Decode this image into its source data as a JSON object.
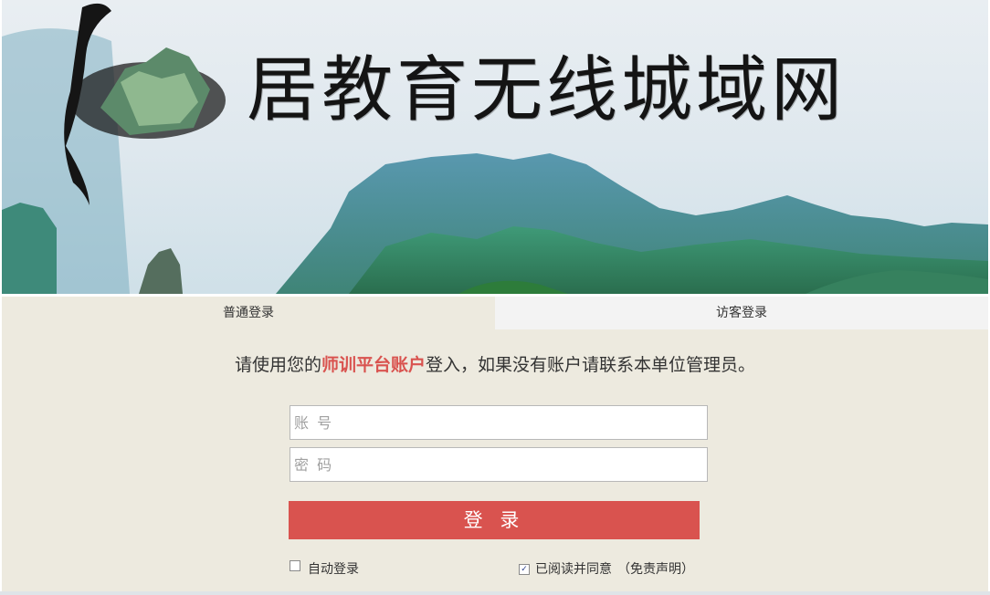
{
  "banner": {
    "title": "居教育无线城域网",
    "logo_icon": "ink-mountain-logo-icon"
  },
  "tabs": [
    {
      "label": "普通登录",
      "active": true
    },
    {
      "label": "访客登录",
      "active": false
    }
  ],
  "notice": {
    "prefix": "请使用您的",
    "highlight": "师训平台账户",
    "suffix": "登入，如果没有账户请联系本单位管理员。"
  },
  "form": {
    "account_placeholder": "账 号",
    "account_value": "",
    "password_placeholder": "密 码",
    "password_value": "",
    "login_label": "登 录"
  },
  "options": {
    "auto_login_label": "自动登录",
    "auto_login_checked": false,
    "agree_label": "已阅读并同意",
    "agree_checked": true,
    "disclaimer_label": "（免责声明）"
  },
  "colors": {
    "accent": "#d9534f",
    "panel_bg": "#edeadf",
    "guest_tab_bg": "#f3f3f3"
  }
}
